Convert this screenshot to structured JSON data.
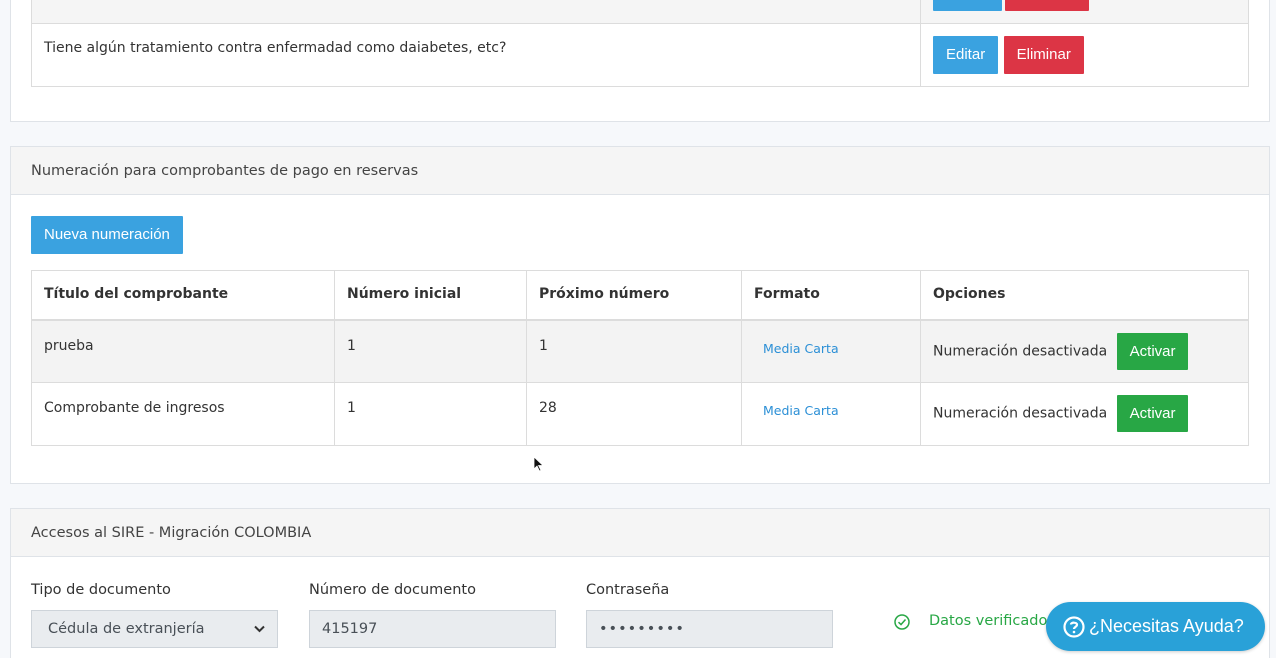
{
  "questions_panel": {
    "row_text": "Tiene algún tratamiento contra enfermadad como daiabetes, etc?",
    "edit_label": "Editar",
    "delete_label": "Eliminar"
  },
  "numbering_panel": {
    "title": "Numeración para comprobantes de pago en reservas",
    "new_button": "Nueva numeración",
    "columns": [
      "Título del comprobante",
      "Número inicial",
      "Próximo número",
      "Formato",
      "Opciones"
    ],
    "rows": [
      {
        "title": "prueba",
        "start": "1",
        "next": "1",
        "format": "Media Carta",
        "status": "Numeración desactivada",
        "action": "Activar"
      },
      {
        "title": "Comprobante de ingresos",
        "start": "1",
        "next": "28",
        "format": "Media Carta",
        "status": "Numeración desactivada",
        "action": "Activar"
      }
    ]
  },
  "sire_panel": {
    "title": "Accesos al SIRE - Migración COLOMBIA",
    "doc_type_label": "Tipo de documento",
    "doc_type_value": "Cédula de extranjería",
    "doc_number_label": "Número de documento",
    "doc_number_value": "415197",
    "password_label": "Contraseña",
    "password_value": "•••••••••",
    "verified_text": "Datos verificados"
  },
  "help_button": {
    "label": "¿Necesitas Ayuda?"
  },
  "colors": {
    "primary": "#3aa2e0",
    "danger": "#dc3545",
    "success": "#28a745",
    "verified": "#28a745"
  }
}
